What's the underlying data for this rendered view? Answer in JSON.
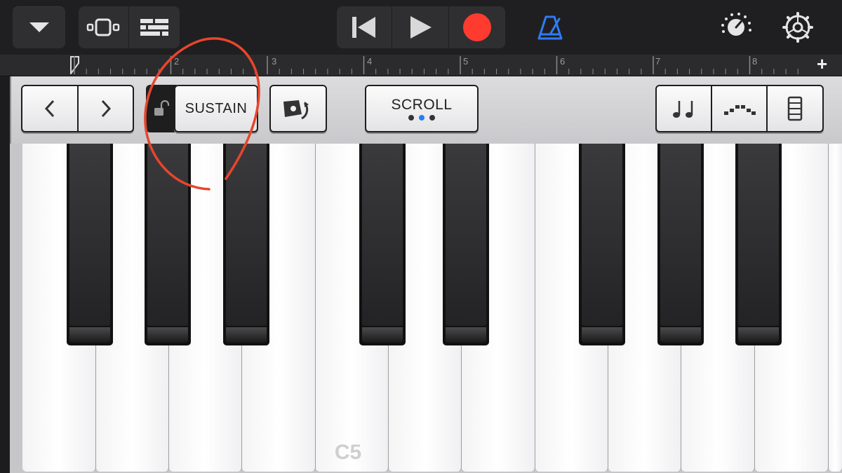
{
  "ruler": {
    "marks": [
      "2",
      "3",
      "4",
      "5",
      "6",
      "7",
      "8"
    ],
    "add_label": "+"
  },
  "controls": {
    "sustain_label": "SUSTAIN",
    "scroll_label": "SCROLL"
  },
  "keyboard": {
    "octave_label": "C5"
  },
  "colors": {
    "record": "#ff3b30",
    "metronome": "#2f7bf5",
    "annotation": "#e8452d"
  },
  "icons": {
    "menu": "chevron-down-icon",
    "tracks_view": "tracks-view-icon",
    "mixer": "mixer-icon",
    "rewind": "rewind-icon",
    "play": "play-icon",
    "record": "record-icon",
    "metronome": "metronome-icon",
    "master_volume": "knob-icon",
    "settings": "gear-icon"
  }
}
